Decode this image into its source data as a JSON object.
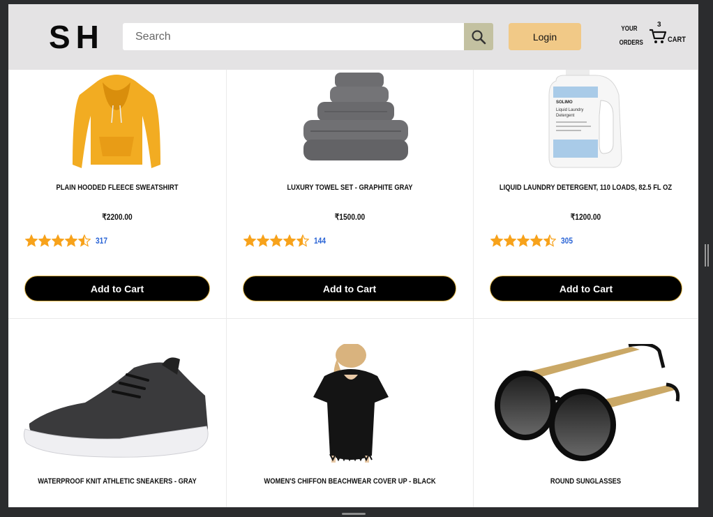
{
  "header": {
    "logo": "SH",
    "search_placeholder": "Search",
    "login_label": "Login",
    "orders_line1": "YOUR",
    "orders_line2": "ORDERS",
    "cart_count": "3",
    "cart_label": "CART",
    "icons": {
      "search": "search-icon",
      "cart": "cart-icon"
    }
  },
  "colors": {
    "header_bg": "#e4e3e4",
    "login_bg": "#f1c987",
    "search_button_bg": "#c3c1a1",
    "star": "#f7a21b",
    "rating_count": "#2a64d6",
    "button_bg": "#000000"
  },
  "products": [
    {
      "title": "PLAIN HOODED FLEECE SWEATSHIRT",
      "price": "₹2200.00",
      "rating": 4.5,
      "rating_count": "317",
      "button": "Add to Cart",
      "image": "hoodie"
    },
    {
      "title": "LUXURY TOWEL SET - GRAPHITE GRAY",
      "price": "₹1500.00",
      "rating": 4.5,
      "rating_count": "144",
      "button": "Add to Cart",
      "image": "towels"
    },
    {
      "title": "LIQUID LAUNDRY DETERGENT, 110 LOADS, 82.5 FL OZ",
      "price": "₹1200.00",
      "rating": 4.5,
      "rating_count": "305",
      "button": "Add to Cart",
      "image": "detergent",
      "label_lines": [
        "SOLIMO",
        "Liquid Laundry",
        "Detergent"
      ]
    },
    {
      "title": "WATERPROOF KNIT ATHLETIC SNEAKERS - GRAY",
      "image": "sneaker"
    },
    {
      "title": "WOMEN'S CHIFFON BEACHWEAR COVER UP - BLACK",
      "image": "coverup"
    },
    {
      "title": "ROUND SUNGLASSES",
      "image": "sunglasses"
    }
  ]
}
